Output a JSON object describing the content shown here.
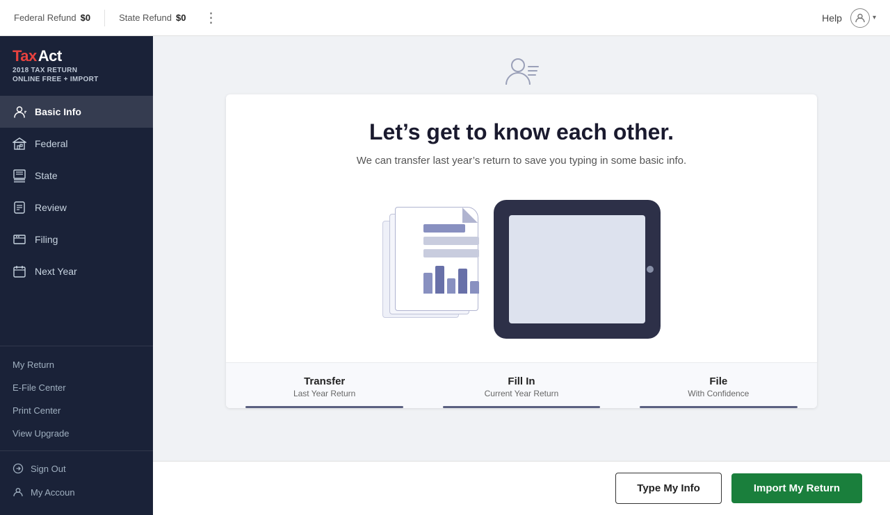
{
  "topbar": {
    "federal_refund_label": "Federal Refund",
    "federal_refund_amount": "$0",
    "state_refund_label": "State Refund",
    "state_refund_amount": "$0",
    "help_label": "Help"
  },
  "brand": {
    "tax": "Tax",
    "act": "Act",
    "year_label": "2018 TAX RETURN",
    "plan_label": "ONLINE FREE + IMPORT"
  },
  "sidebar": {
    "nav_items": [
      {
        "id": "basic-info",
        "label": "Basic Info",
        "icon": "user-icon",
        "active": true
      },
      {
        "id": "federal",
        "label": "Federal",
        "icon": "building-icon",
        "active": false
      },
      {
        "id": "state",
        "label": "State",
        "icon": "flag-icon",
        "active": false
      },
      {
        "id": "review",
        "label": "Review",
        "icon": "review-icon",
        "active": false
      },
      {
        "id": "filing",
        "label": "Filing",
        "icon": "filing-icon",
        "active": false
      },
      {
        "id": "next-year",
        "label": "Next Year",
        "icon": "calendar-icon",
        "active": false
      }
    ],
    "utilities": [
      {
        "id": "my-return",
        "label": "My Return"
      },
      {
        "id": "efile-center",
        "label": "E-File Center"
      },
      {
        "id": "print-center",
        "label": "Print Center"
      },
      {
        "id": "view-upgrade",
        "label": "View Upgrade"
      }
    ],
    "bottom_items": [
      {
        "id": "sign-out",
        "label": "Sign Out",
        "icon": "signout-icon"
      },
      {
        "id": "my-account",
        "label": "My Accoun",
        "icon": "account-icon"
      }
    ]
  },
  "main": {
    "person_icon": "person-lines-icon",
    "title": "Let’s get to know each other.",
    "subtitle": "We can transfer last year’s return to save you typing in some basic info.",
    "steps": [
      {
        "id": "transfer",
        "title": "Transfer",
        "sub": "Last Year Return"
      },
      {
        "id": "fill-in",
        "title": "Fill In",
        "sub": "Current Year Return"
      },
      {
        "id": "file",
        "title": "File",
        "sub": "With Confidence"
      }
    ]
  },
  "actions": {
    "type_info_label": "Type My Info",
    "import_label": "Import My Return"
  }
}
